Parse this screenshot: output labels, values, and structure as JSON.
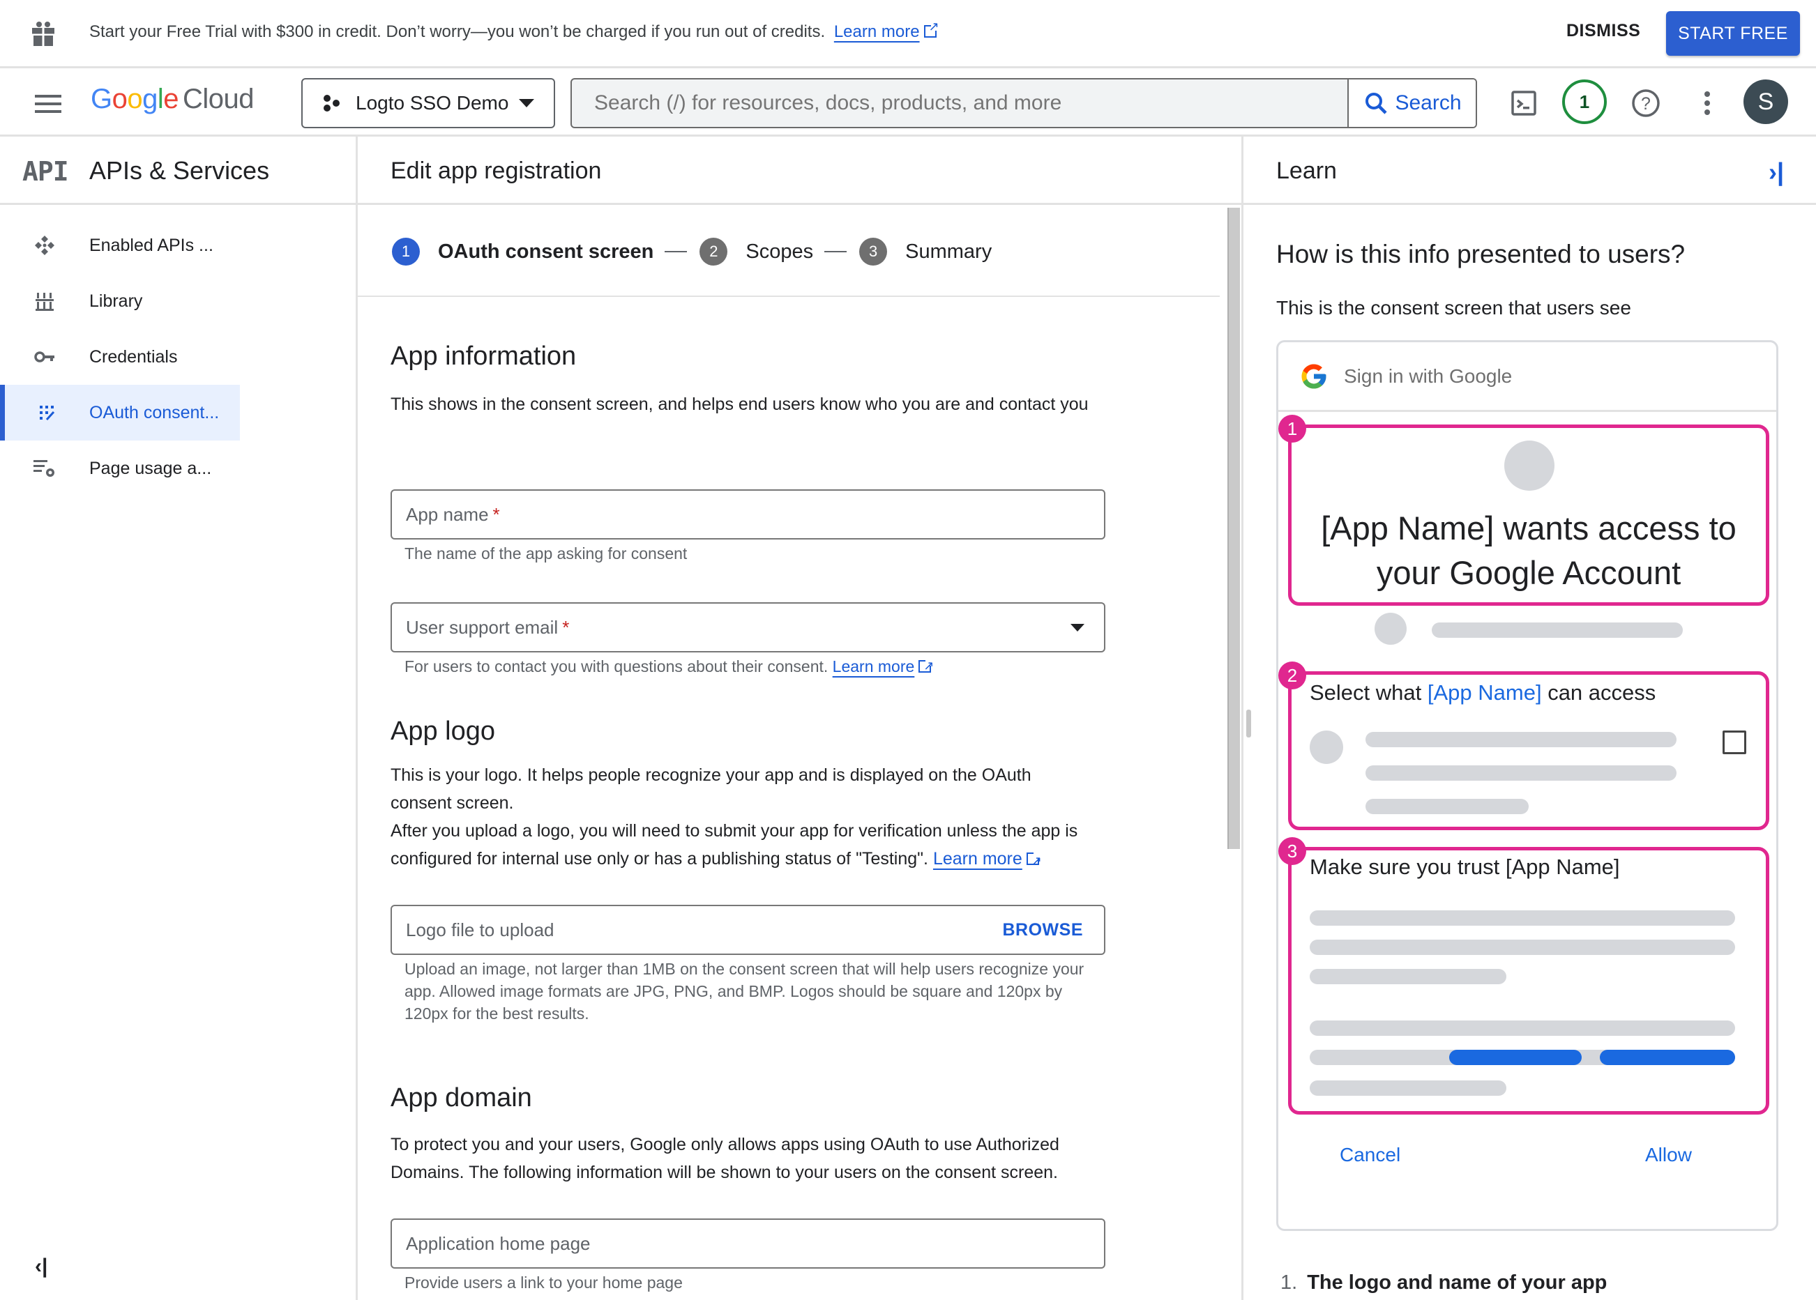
{
  "banner": {
    "text": "Start your Free Trial with $300 in credit. Don’t worry—you won’t be charged if you run out of credits.",
    "learn_more": "Learn more",
    "dismiss": "DISMISS",
    "start_free": "START FREE"
  },
  "header": {
    "logo_google": [
      "G",
      "o",
      "o",
      "g",
      "l",
      "e"
    ],
    "logo_cloud": "Cloud",
    "project": "Logto SSO Demo",
    "search_placeholder": "Search (/) for resources, docs, products, and more",
    "search_button": "Search",
    "notifications_count": "1",
    "avatar_initial": "S"
  },
  "colors": {
    "accent": "#2c5fd0",
    "highlight": "#e0278f",
    "link": "#1a5bd6",
    "notif": "#1e8e3e"
  },
  "sidebar": {
    "logo": "API",
    "title": "APIs & Services",
    "items": [
      {
        "label": "Enabled APIs ...",
        "icon": "enabled-apis-icon"
      },
      {
        "label": "Library",
        "icon": "library-icon"
      },
      {
        "label": "Credentials",
        "icon": "key-icon"
      },
      {
        "label": "OAuth consent...",
        "icon": "oauth-consent-icon",
        "active": true
      },
      {
        "label": "Page usage a...",
        "icon": "page-usage-icon"
      }
    ]
  },
  "main": {
    "title": "Edit app registration",
    "steps": [
      {
        "num": "1",
        "label": "OAuth consent screen",
        "active": true
      },
      {
        "num": "2",
        "label": "Scopes"
      },
      {
        "num": "3",
        "label": "Summary"
      }
    ],
    "app_info": {
      "heading": "App information",
      "desc": "This shows in the consent screen, and helps end users know who you are and contact you",
      "app_name_label": "App name",
      "app_name_hint": "The name of the app asking for consent",
      "support_email_label": "User support email",
      "support_email_hint": "For users to contact you with questions about their consent.",
      "learn_more": "Learn more",
      "required_mark": "*"
    },
    "app_logo": {
      "heading": "App logo",
      "desc1": "This is your logo. It helps people recognize your app and is displayed on the OAuth consent screen.",
      "desc2": "After you upload a logo, you will need to submit your app for verification unless the app is configured for internal use only or has a publishing status of \"Testing\".",
      "learn_more": "Learn more",
      "file_label": "Logo file to upload",
      "browse": "BROWSE",
      "hint": "Upload an image, not larger than 1MB on the consent screen that will help users recognize your app. Allowed image formats are JPG, PNG, and BMP. Logos should be square and 120px by 120px for the best results."
    },
    "app_domain": {
      "heading": "App domain",
      "desc": "To protect you and your users, Google only allows apps using OAuth to use Authorized Domains. The following information will be shown to your users on the consent screen.",
      "home_label": "Application home page",
      "home_hint": "Provide users a link to your home page"
    }
  },
  "learn": {
    "title": "Learn",
    "heading": "How is this info presented to users?",
    "sub": "This is the consent screen that users see",
    "card": {
      "header": "Sign in with Google",
      "box1_num": "1",
      "box1_text": "[App Name] wants access to your Google Account",
      "box2_num": "2",
      "box2_pre": "Select what ",
      "box2_app": "[App Name]",
      "box2_post": " can access",
      "box3_num": "3",
      "box3_text": "Make sure you trust [App Name]",
      "cancel": "Cancel",
      "allow": "Allow"
    },
    "list": [
      {
        "num": "1.",
        "text": "The logo and name of your app"
      }
    ]
  }
}
